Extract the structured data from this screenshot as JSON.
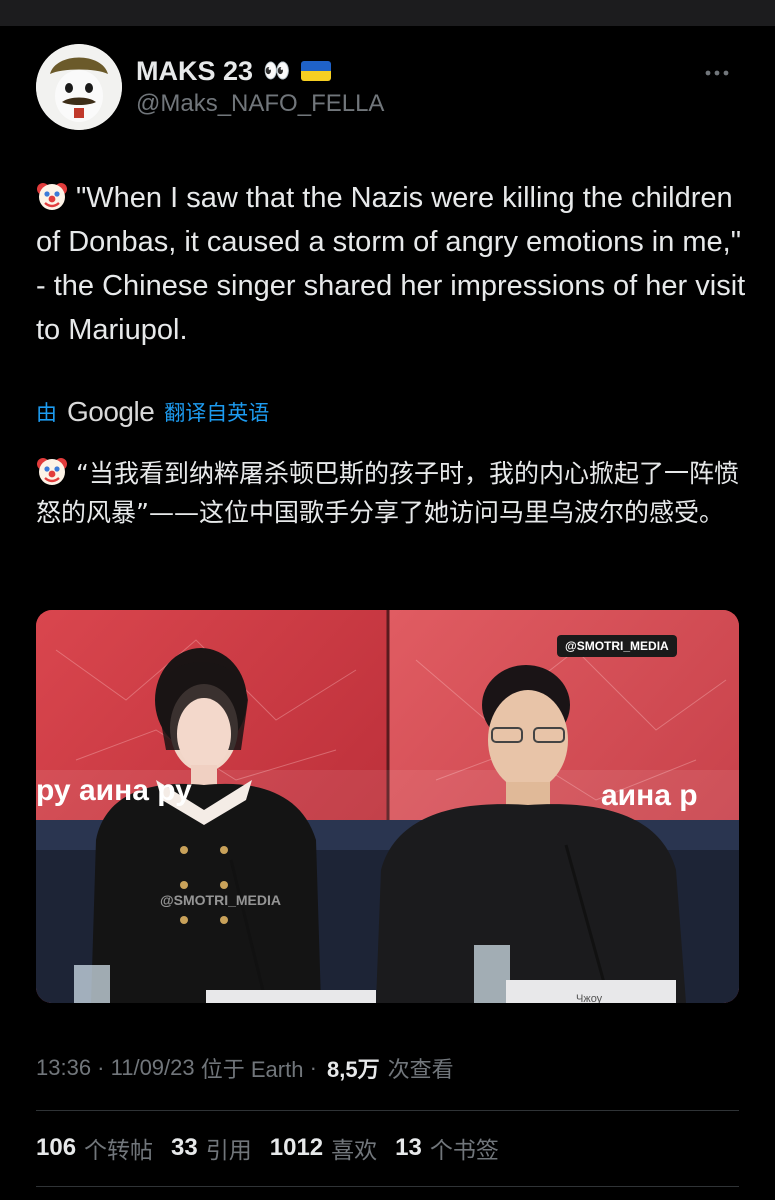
{
  "author": {
    "display_name": "MAKS 23",
    "eyes_emoji": "👀",
    "handle": "@Maks_NAFO_FELLA"
  },
  "more_icon": "more-options-icon",
  "tweet": {
    "emoji": "clown-face-emoji",
    "text": "\"When I saw that the Nazis were killing the children of Donbas, it caused a storm of angry emotions in me,\" - the Chinese singer shared her impressions of her visit to Mariupol."
  },
  "translation_header": {
    "by": "由",
    "provider": "Google",
    "from_label": "翻译自英语"
  },
  "translation": {
    "text": "“当我看到纳粹屠杀顿巴斯的孩子时，我的内心掀起了一阵愤怒的风暴”——这位中国歌手分享了她访问马里乌波尔的感受。"
  },
  "media": {
    "tag": "@SMOTRI_MEDIA",
    "watermark": "@SMOTRI_MEDIA",
    "left_backdrop": "ру        аина ру",
    "right_backdrop": "аина р",
    "nameplate": "Чжоу"
  },
  "meta": {
    "time": "13:36",
    "sep1": " · ",
    "date": "11/09/23",
    "location": " 位于 Earth",
    "sep2": " · ",
    "views_count": "8,5万",
    "views_label": "次查看"
  },
  "stats": {
    "reposts_count": "106",
    "reposts_label": "个转帖",
    "quotes_count": "33",
    "quotes_label": "引用",
    "likes_count": "1012",
    "likes_label": "喜欢",
    "bookmarks_count": "13",
    "bookmarks_label": "个书签"
  },
  "colors": {
    "background": "#000000",
    "text": "#e7e9ea",
    "secondary": "#71767b",
    "link": "#1d9bf0",
    "divider": "#2f3336"
  }
}
